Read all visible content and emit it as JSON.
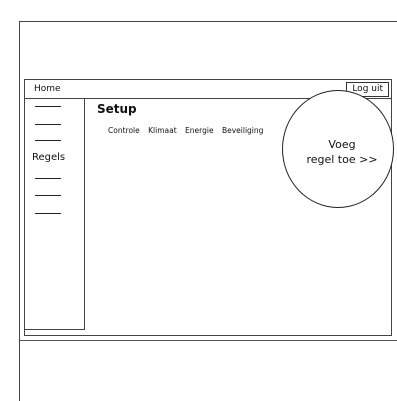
{
  "topbar": {
    "home_label": "Home",
    "logout_label": "Log uit"
  },
  "sidebar": {
    "label": "Regels"
  },
  "main": {
    "title": "Setup",
    "tabs": [
      {
        "label": "Controle"
      },
      {
        "label": "Klimaat"
      },
      {
        "label": "Energie"
      },
      {
        "label": "Beveiliging"
      }
    ]
  },
  "cta": {
    "line1": "Voeg",
    "line2": "regel toe >>"
  }
}
